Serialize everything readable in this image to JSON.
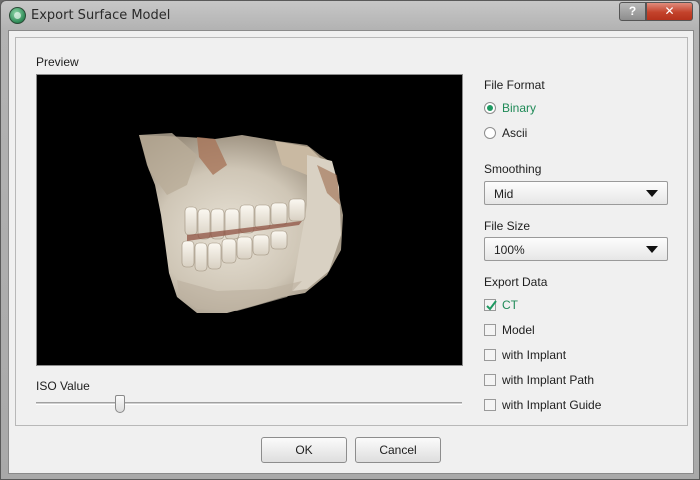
{
  "window": {
    "title": "Export Surface Model",
    "help_label": "?",
    "close_label": "✕"
  },
  "preview": {
    "label": "Preview"
  },
  "iso": {
    "label": "ISO Value",
    "value_fraction": 0.19
  },
  "file_format": {
    "label": "File Format",
    "options": [
      {
        "label": "Binary",
        "selected": true
      },
      {
        "label": "Ascii",
        "selected": false
      }
    ]
  },
  "smoothing": {
    "label": "Smoothing",
    "value": "Mid"
  },
  "file_size": {
    "label": "File Size",
    "value": "100%"
  },
  "export_data": {
    "label": "Export Data",
    "items": [
      {
        "label": "CT",
        "checked": true
      },
      {
        "label": "Model",
        "checked": false
      },
      {
        "label": "with Implant",
        "checked": false
      },
      {
        "label": "with Implant Path",
        "checked": false
      },
      {
        "label": "with Implant Guide",
        "checked": false
      }
    ]
  },
  "buttons": {
    "ok": "OK",
    "cancel": "Cancel"
  },
  "colors": {
    "accent": "#1f8a57"
  }
}
